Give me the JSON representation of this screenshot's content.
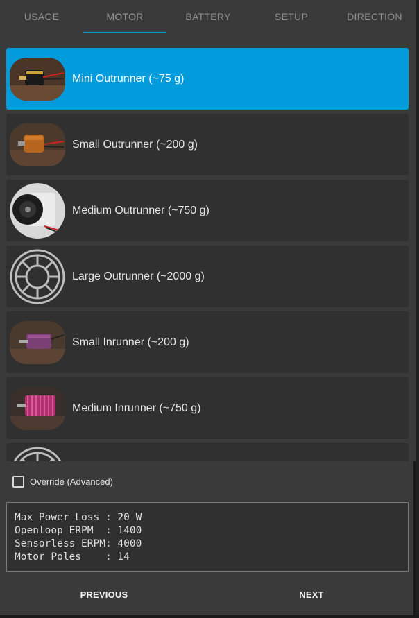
{
  "tabs": [
    {
      "label": "USAGE"
    },
    {
      "label": "MOTOR"
    },
    {
      "label": "BATTERY"
    },
    {
      "label": "SETUP"
    },
    {
      "label": "DIRECTION"
    }
  ],
  "active_tab": "MOTOR",
  "motors": [
    {
      "label": "Mini Outrunner (~75 g)",
      "icon": "motor-photo",
      "selected": true
    },
    {
      "label": "Small Outrunner (~200 g)",
      "icon": "motor-photo",
      "selected": false
    },
    {
      "label": "Medium Outrunner (~750 g)",
      "icon": "motor-photo",
      "selected": false
    },
    {
      "label": "Large Outrunner (~2000 g)",
      "icon": "stator-icon",
      "selected": false
    },
    {
      "label": "Small Inrunner (~200 g)",
      "icon": "motor-photo",
      "selected": false
    },
    {
      "label": "Medium Inrunner (~750 g)",
      "icon": "motor-photo",
      "selected": false
    },
    {
      "label": "",
      "icon": "stator-icon",
      "selected": false
    }
  ],
  "override": {
    "label": "Override (Advanced)",
    "checked": false
  },
  "info": [
    "Max Power Loss : 20 W",
    "Openloop ERPM  : 1400",
    "Sensorless ERPM: 4000",
    "Motor Poles    : 14"
  ],
  "buttons": {
    "previous": "PREVIOUS",
    "next": "NEXT"
  },
  "colors": {
    "accent": "#029bdc",
    "background": "#3a3a3a",
    "item_bg": "#303030",
    "tab_text": "#8f8f8f"
  }
}
